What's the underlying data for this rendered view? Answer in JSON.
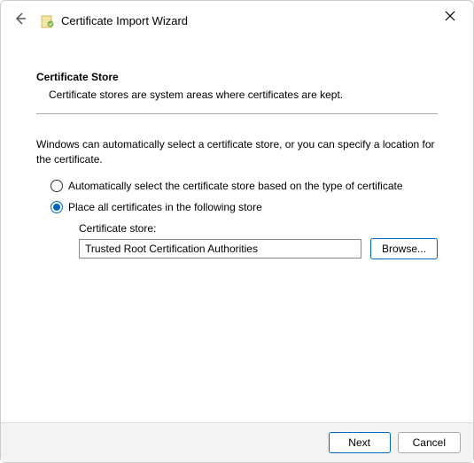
{
  "window": {
    "title": "Certificate Import Wizard"
  },
  "section": {
    "heading": "Certificate Store",
    "sub": "Certificate stores are system areas where certificates are kept."
  },
  "body": {
    "intro": "Windows can automatically select a certificate store, or you can specify a location for the certificate.",
    "radio_auto": "Automatically select the certificate store based on the type of certificate",
    "radio_place": "Place all certificates in the following store",
    "store_label": "Certificate store:",
    "store_value": "Trusted Root Certification Authorities",
    "browse": "Browse..."
  },
  "footer": {
    "next": "Next",
    "cancel": "Cancel"
  }
}
